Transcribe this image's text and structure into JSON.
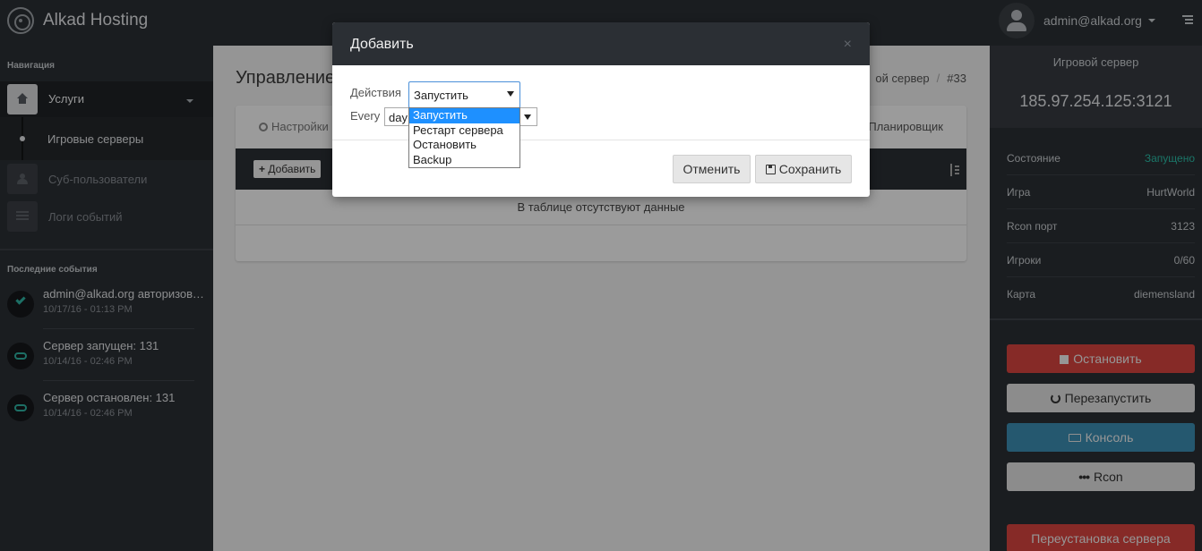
{
  "header": {
    "brand": "Alkad Hosting",
    "user_email": "admin@alkad.org",
    "logo_icon": "target-logo-icon",
    "menu_icon": "hamburger-icon"
  },
  "sidebar": {
    "nav_title": "Навигация",
    "items": [
      {
        "label": "Услуги",
        "icon": "home-icon"
      },
      {
        "label": "Игровые серверы"
      },
      {
        "label": "Суб-пользователи",
        "icon": "users-icon"
      },
      {
        "label": "Логи событий",
        "icon": "list-icon"
      }
    ],
    "events_title": "Последние события",
    "events": [
      {
        "title": "admin@alkad.org авторизовался",
        "time": "10/17/16 - 01:13 PM",
        "icon": "check-icon"
      },
      {
        "title": "Сервер запущен: 131",
        "time": "10/14/16 - 02:46 PM",
        "icon": "gamepad-icon"
      },
      {
        "title": "Сервер остановлен: 131",
        "time": "10/14/16 - 02:46 PM",
        "icon": "gamepad-icon"
      }
    ]
  },
  "main": {
    "title": "Управление",
    "breadcrumb": [
      "ой сервер",
      "#33"
    ],
    "tabs": {
      "settings": "Настройки",
      "scheduler": "Планировщик"
    },
    "add_button": "Добавить",
    "empty_text": "В таблице отсутствуют данные"
  },
  "right_panel": {
    "title": "Игровой сервер",
    "ip": "185.97.254.125:3121",
    "info": [
      {
        "key": "Состояние",
        "value": "Запущено",
        "color": "#2bbfa8"
      },
      {
        "key": "Игра",
        "value": "HurtWorld"
      },
      {
        "key": "Rcon порт",
        "value": "3123"
      },
      {
        "key": "Игроки",
        "value": "0/60"
      },
      {
        "key": "Карта",
        "value": "diemensland"
      }
    ],
    "buttons": {
      "stop": "Остановить",
      "restart": "Перезапустить",
      "console": "Консоль",
      "rcon": "Rcon",
      "reinstall": "Переустановка сервера"
    }
  },
  "modal": {
    "title": "Добавить",
    "close": "×",
    "action_label": "Действия",
    "action_value": "Запустить",
    "every_label": "Every",
    "every_value": "day",
    "options": [
      "Запустить",
      "Рестарт сервера",
      "Остановить",
      "Backup"
    ],
    "cancel": "Отменить",
    "save": "Сохранить"
  },
  "colors": {
    "accent_green": "#2bbfa8",
    "danger": "#d9443f",
    "info": "#3d8fb3",
    "dark": "#2b2f34"
  }
}
